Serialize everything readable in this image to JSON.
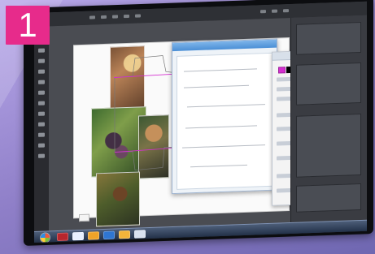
{
  "badge": {
    "step_number": "1"
  },
  "colors": {
    "badge_background": "#e72b8b",
    "die_line_magenta": "#d42fd0",
    "screen_dark": "#3d3f45",
    "taskbar": "#1f2d44"
  },
  "icons": {
    "start": "windows-start-icon",
    "app_1": "adobe-illustrator-icon",
    "app_2": "pdf-icon",
    "app_3": "folder-icon",
    "app_4": "browser-icon",
    "app_5": "media-icon",
    "app_6": "calculator-icon"
  }
}
